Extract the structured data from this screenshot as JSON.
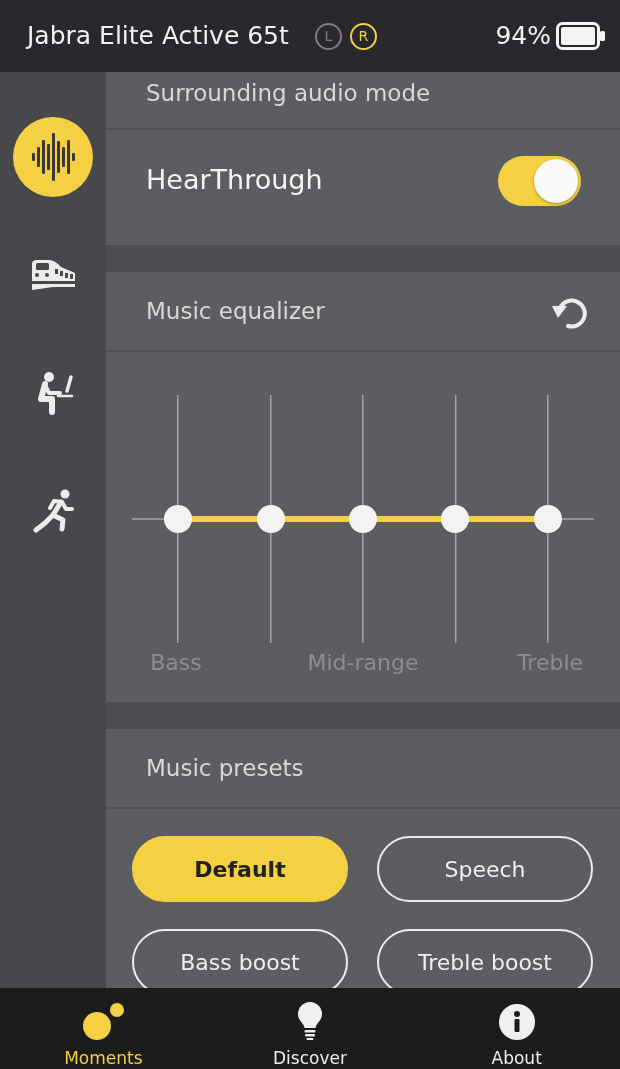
{
  "header": {
    "device_name": "Jabra Elite Active 65t",
    "earbuds": [
      {
        "label": "L",
        "connected": false
      },
      {
        "label": "R",
        "connected": true
      }
    ],
    "battery": "94%"
  },
  "sidebar": {
    "items": [
      {
        "kind": "sound-wave",
        "selected": true
      },
      {
        "kind": "train",
        "selected": false
      },
      {
        "kind": "desk",
        "selected": false
      },
      {
        "kind": "running",
        "selected": false
      }
    ]
  },
  "surrounding_audio": {
    "title": "Surrounding audio mode",
    "mode": {
      "label": "HearThrough",
      "on": true
    }
  },
  "equalizer": {
    "title": "Music equalizer",
    "bands": [
      {
        "label": "Bass",
        "level": 0.5
      },
      {
        "level": 0.5
      },
      {
        "label": "Mid-range",
        "level": 0.5
      },
      {
        "level": 0.5
      },
      {
        "label": "Treble",
        "level": 0.5
      }
    ]
  },
  "presets": {
    "title": "Music presets",
    "items": [
      {
        "label": "Default",
        "selected": true
      },
      {
        "label": "Speech",
        "selected": false
      },
      {
        "label": "Bass boost",
        "selected": false
      },
      {
        "label": "Treble boost",
        "selected": false
      }
    ]
  },
  "tab_bar": {
    "tabs": [
      {
        "kind": "moments",
        "label": "Moments",
        "selected": true
      },
      {
        "kind": "discover",
        "label": "Discover",
        "selected": false
      },
      {
        "kind": "about",
        "label": "About",
        "selected": false
      }
    ]
  }
}
